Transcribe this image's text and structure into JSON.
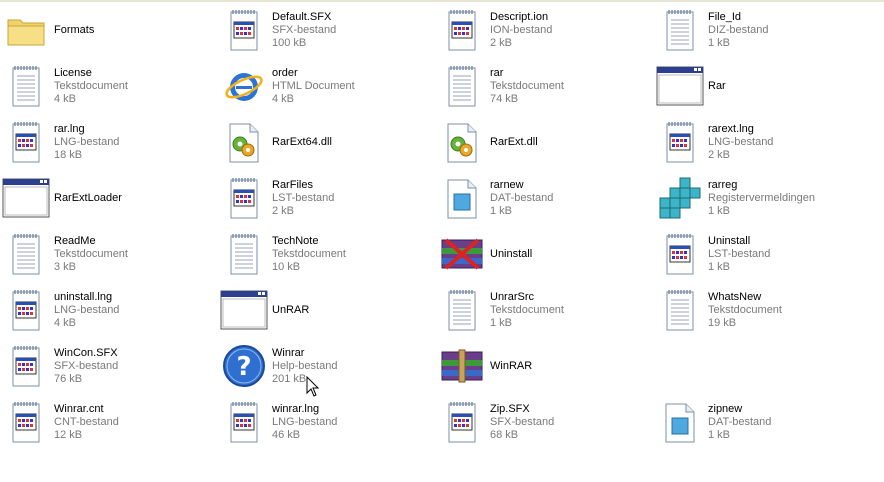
{
  "files": [
    {
      "name": "Formats",
      "type": "",
      "size": "",
      "icon": "folder-icon"
    },
    {
      "name": "Default.SFX",
      "type": "SFX-bestand",
      "size": "100 kB",
      "icon": "app-doc-icon"
    },
    {
      "name": "Descript.ion",
      "type": "ION-bestand",
      "size": "2 kB",
      "icon": "app-doc-icon"
    },
    {
      "name": "File_Id",
      "type": "DIZ-bestand",
      "size": "1 kB",
      "icon": "text-doc-icon"
    },
    {
      "name": "License",
      "type": "Tekstdocument",
      "size": "4 kB",
      "icon": "text-doc-icon"
    },
    {
      "name": "order",
      "type": "HTML Document",
      "size": "4 kB",
      "icon": "ie-icon"
    },
    {
      "name": "rar",
      "type": "Tekstdocument",
      "size": "74 kB",
      "icon": "text-doc-icon"
    },
    {
      "name": "Rar",
      "type": "",
      "size": "",
      "icon": "window-icon"
    },
    {
      "name": "rar.lng",
      "type": "LNG-bestand",
      "size": "18 kB",
      "icon": "app-doc-icon"
    },
    {
      "name": "RarExt64.dll",
      "type": "",
      "size": "",
      "icon": "dll-icon"
    },
    {
      "name": "RarExt.dll",
      "type": "",
      "size": "",
      "icon": "dll-icon"
    },
    {
      "name": "rarext.lng",
      "type": "LNG-bestand",
      "size": "2 kB",
      "icon": "app-doc-icon"
    },
    {
      "name": "RarExtLoader",
      "type": "",
      "size": "",
      "icon": "window-icon"
    },
    {
      "name": "RarFiles",
      "type": "LST-bestand",
      "size": "2 kB",
      "icon": "app-doc-icon"
    },
    {
      "name": "rarnew",
      "type": "DAT-bestand",
      "size": "1 kB",
      "icon": "dat-icon"
    },
    {
      "name": "rarreg",
      "type": "Registervermeldingen",
      "size": "1 kB",
      "icon": "registry-icon"
    },
    {
      "name": "ReadMe",
      "type": "Tekstdocument",
      "size": "3 kB",
      "icon": "text-doc-icon"
    },
    {
      "name": "TechNote",
      "type": "Tekstdocument",
      "size": "10 kB",
      "icon": "text-doc-icon"
    },
    {
      "name": "Uninstall",
      "type": "",
      "size": "",
      "icon": "uninstall-icon"
    },
    {
      "name": "Uninstall",
      "type": "LST-bestand",
      "size": "1 kB",
      "icon": "app-doc-icon"
    },
    {
      "name": "uninstall.lng",
      "type": "LNG-bestand",
      "size": "4 kB",
      "icon": "app-doc-icon"
    },
    {
      "name": "UnRAR",
      "type": "",
      "size": "",
      "icon": "window-icon"
    },
    {
      "name": "UnrarSrc",
      "type": "Tekstdocument",
      "size": "1 kB",
      "icon": "text-doc-icon"
    },
    {
      "name": "WhatsNew",
      "type": "Tekstdocument",
      "size": "19 kB",
      "icon": "text-doc-icon"
    },
    {
      "name": "WinCon.SFX",
      "type": "SFX-bestand",
      "size": "76 kB",
      "icon": "app-doc-icon"
    },
    {
      "name": "Winrar",
      "type": "Help-bestand",
      "size": "201 kB",
      "icon": "help-icon"
    },
    {
      "name": "WinRAR",
      "type": "",
      "size": "",
      "icon": "winrar-icon"
    },
    {
      "name": "",
      "type": "",
      "size": "",
      "icon": ""
    },
    {
      "name": "Winrar.cnt",
      "type": "CNT-bestand",
      "size": "12 kB",
      "icon": "app-doc-icon"
    },
    {
      "name": "winrar.lng",
      "type": "LNG-bestand",
      "size": "46 kB",
      "icon": "app-doc-icon"
    },
    {
      "name": "Zip.SFX",
      "type": "SFX-bestand",
      "size": "68 kB",
      "icon": "app-doc-icon"
    },
    {
      "name": "zipnew",
      "type": "DAT-bestand",
      "size": "1 kB",
      "icon": "dat-icon"
    }
  ]
}
